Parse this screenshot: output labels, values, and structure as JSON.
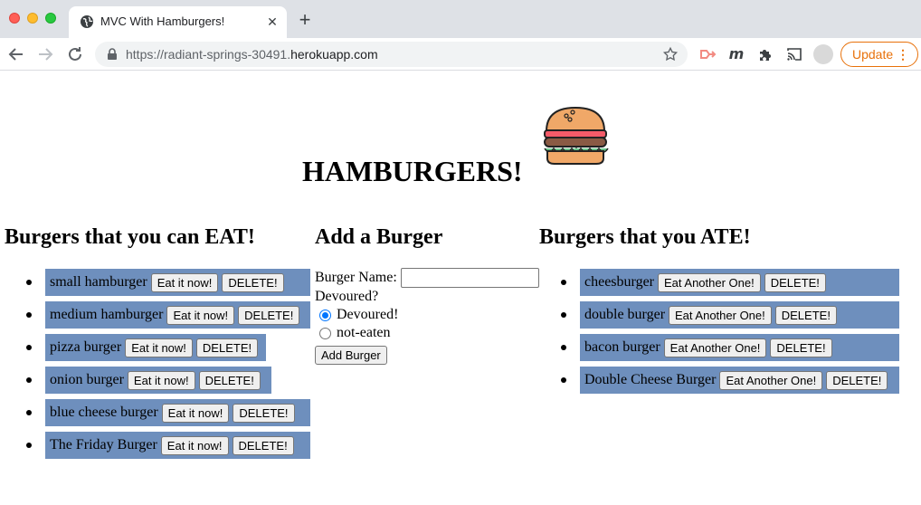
{
  "browser": {
    "tab_title": "MVC With Hamburgers!",
    "url_prefix": "https://radiant-springs-30491.",
    "url_host": "herokuapp.com",
    "update_label": "Update",
    "update_color": "#e8710a"
  },
  "page": {
    "title": "HAMBURGERS!",
    "logo_icon": "hamburger-icon",
    "eat_heading": "Burgers that you can EAT!",
    "add_heading": "Add a Burger",
    "ate_heading": "Burgers that you ATE!",
    "item_bg_color": "#6e8fbd"
  },
  "uneaten": [
    {
      "name": "small hamburger",
      "eat_label": "Eat it now!",
      "delete_label": "DELETE!"
    },
    {
      "name": "medium hamburger",
      "eat_label": "Eat it now!",
      "delete_label": "DELETE!"
    },
    {
      "name": "pizza burger",
      "eat_label": "Eat it now!",
      "delete_label": "DELETE!"
    },
    {
      "name": "onion burger",
      "eat_label": "Eat it now!",
      "delete_label": "DELETE!"
    },
    {
      "name": "blue cheese burger",
      "eat_label": "Eat it now!",
      "delete_label": "DELETE!"
    },
    {
      "name": "The Friday Burger",
      "eat_label": "Eat it now!",
      "delete_label": "DELETE!"
    }
  ],
  "eaten": [
    {
      "name": "cheesburger",
      "eat_label": "Eat Another One!",
      "delete_label": "DELETE!"
    },
    {
      "name": "double burger",
      "eat_label": "Eat Another One!",
      "delete_label": "DELETE!"
    },
    {
      "name": "bacon burger",
      "eat_label": "Eat Another One!",
      "delete_label": "DELETE!"
    },
    {
      "name": "Double Cheese Burger",
      "eat_label": "Eat Another One!",
      "delete_label": "DELETE!"
    }
  ],
  "form": {
    "name_label": "Burger Name:",
    "name_value": "",
    "devoured_label": "Devoured?",
    "option_devoured": "Devoured!",
    "option_not_eaten": "not-eaten",
    "selected": "Devoured!",
    "submit_label": "Add Burger"
  }
}
